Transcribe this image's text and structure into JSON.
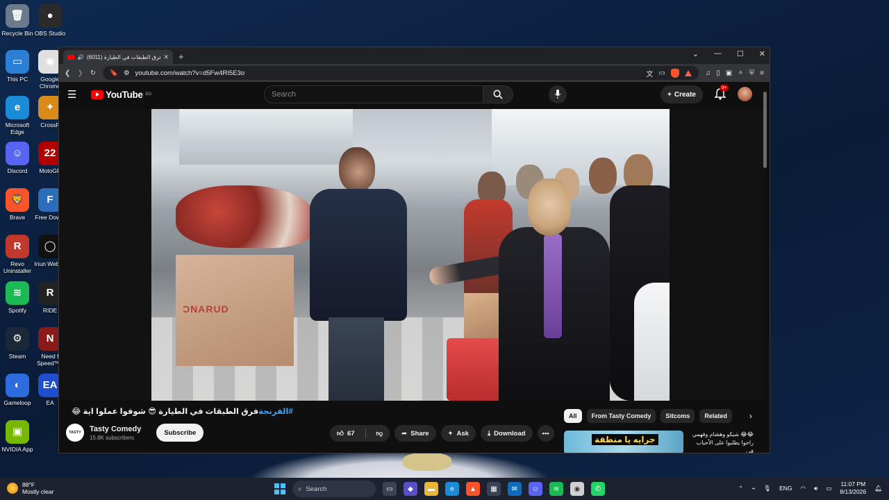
{
  "desktop": {
    "icons": [
      {
        "label": "Recycle Bin",
        "color": "#6b7b8c",
        "glyph": "🗑"
      },
      {
        "label": "OBS Studio",
        "color": "#2b2b2b",
        "glyph": "●"
      },
      {
        "label": "This PC",
        "color": "#2b7fd4",
        "glyph": "▭"
      },
      {
        "label": "Google Chrome",
        "color": "#e0e0e0",
        "glyph": "◉"
      },
      {
        "label": "Microsoft Edge",
        "color": "#1a8bd6",
        "glyph": "e"
      },
      {
        "label": "CrossF",
        "color": "#d98b1a",
        "glyph": "✦"
      },
      {
        "label": "Discord",
        "color": "#5865f2",
        "glyph": "☺"
      },
      {
        "label": "MotoGP",
        "color": "#b00000",
        "glyph": "22"
      },
      {
        "label": "Brave",
        "color": "#fb542b",
        "glyph": "🦁"
      },
      {
        "label": "Free Downl",
        "color": "#2a6ebb",
        "glyph": "F"
      },
      {
        "label": "Revo Uninstaller",
        "color": "#c0392b",
        "glyph": "R"
      },
      {
        "label": "Iriun Webca",
        "color": "#111111",
        "glyph": "◯"
      },
      {
        "label": "Spotify",
        "color": "#1db954",
        "glyph": "≋"
      },
      {
        "label": "RIDE",
        "color": "#222222",
        "glyph": "R"
      },
      {
        "label": "Steam",
        "color": "#1b2838",
        "glyph": "⚙"
      },
      {
        "label": "Need f Speed™ I",
        "color": "#8a1a1a",
        "glyph": "N"
      },
      {
        "label": "Gameloop",
        "color": "#2d6cdf",
        "glyph": "◐"
      },
      {
        "label": "EA",
        "color": "#1f4fd0",
        "glyph": "EA"
      },
      {
        "label": "NVIDIA App",
        "color": "#76b900",
        "glyph": "▣"
      }
    ]
  },
  "browser": {
    "tab_title": "(6011) فرق الطبقات في الطيارة",
    "url": "youtube.com/watch?v=d5Fw4RI5E3o"
  },
  "youtube": {
    "logo_text": "YouTube",
    "region": "EG",
    "search_placeholder": "Search",
    "create_label": "Create",
    "notif_badge": "9+",
    "video": {
      "hashtag": "#الفرنجة",
      "title_rest": "فرق الطبقات في الطيارة 😎 شوفوا عملوا اية 😂",
      "channel": "Tasty Comedy",
      "channel_logo": "TASTY",
      "subscribers": "15.8K subscribers",
      "subscribe_label": "Subscribe",
      "likes": "67",
      "share_label": "Share",
      "ask_label": "Ask",
      "download_label": "Download"
    },
    "chips": [
      "All",
      "From Tasty Comedy",
      "Sitcoms",
      "Related"
    ],
    "related": {
      "thumb_text": "جرايه يا منطقة",
      "title": "😂😂 شيكو وهشام وفهمي راحوا يطلبوا على الأحباب في"
    }
  },
  "taskbar": {
    "temp": "88°F",
    "weather": "Mostly clear",
    "search_label": "Search",
    "lang": "ENG",
    "time": "11:07 PM",
    "date": "8/13/2026"
  }
}
